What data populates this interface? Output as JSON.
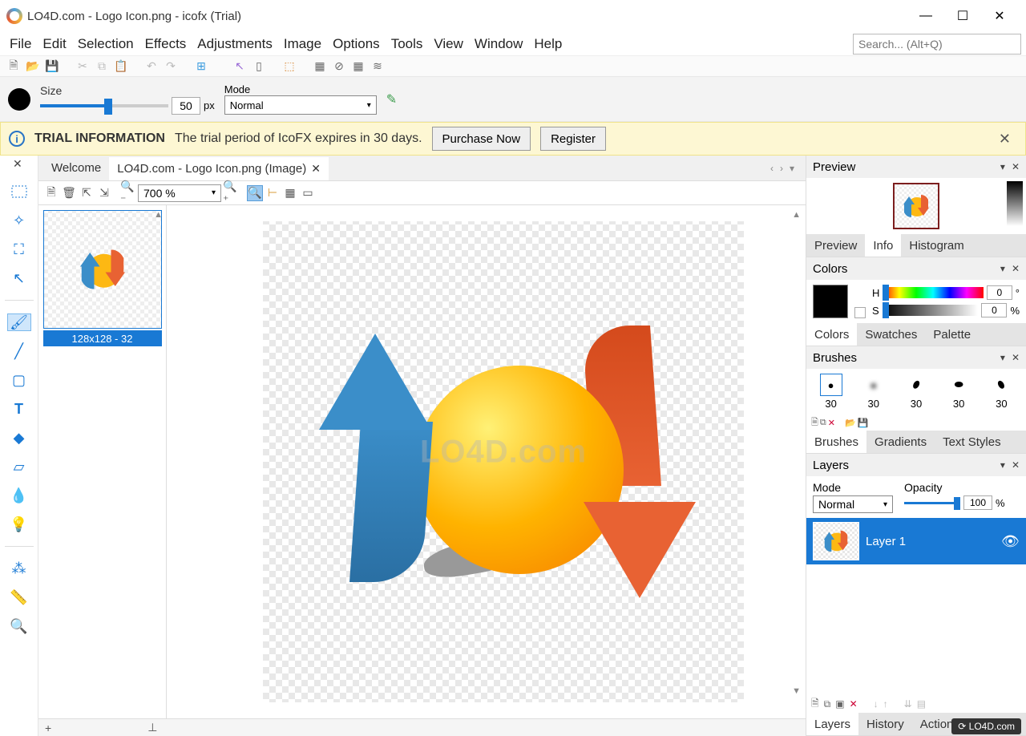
{
  "titlebar": {
    "title": "LO4D.com - Logo Icon.png - icofx (Trial)"
  },
  "menubar": {
    "items": [
      "File",
      "Edit",
      "Selection",
      "Effects",
      "Adjustments",
      "Image",
      "Options",
      "Tools",
      "View",
      "Window",
      "Help"
    ],
    "search_placeholder": "Search... (Alt+Q)"
  },
  "brushbar": {
    "size_label": "Size",
    "size_value": "50",
    "size_unit": "px",
    "mode_label": "Mode",
    "mode_value": "Normal"
  },
  "trial": {
    "title": "TRIAL INFORMATION",
    "message": "The trial period of IcoFX expires in 30 days.",
    "purchase_btn": "Purchase Now",
    "register_btn": "Register"
  },
  "tabs": {
    "welcome": "Welcome",
    "doc": "LO4D.com - Logo Icon.png (Image)"
  },
  "imgtoolbar": {
    "zoom_value": "700 %"
  },
  "thumb": {
    "label": "128x128 - 32"
  },
  "panels": {
    "preview": {
      "title": "Preview",
      "tabs": [
        "Preview",
        "Info",
        "Histogram"
      ],
      "active": 1
    },
    "colors": {
      "title": "Colors",
      "h_label": "H",
      "h_value": "0",
      "h_unit": "°",
      "s_label": "S",
      "s_value": "0",
      "s_unit": "%",
      "tabs": [
        "Colors",
        "Swatches",
        "Palette"
      ]
    },
    "brushes": {
      "title": "Brushes",
      "sizes": [
        "30",
        "30",
        "30",
        "30",
        "30"
      ],
      "tabs": [
        "Brushes",
        "Gradients",
        "Text Styles"
      ]
    },
    "layers": {
      "title": "Layers",
      "mode_label": "Mode",
      "mode_value": "Normal",
      "opacity_label": "Opacity",
      "opacity_value": "100",
      "opacity_unit": "%",
      "layer_name": "Layer 1",
      "tabs": [
        "Layers",
        "History",
        "Actions"
      ]
    }
  },
  "watermark": "LO4D.com",
  "branding": "LO4D.com",
  "statusbar": {
    "plus": "+"
  }
}
